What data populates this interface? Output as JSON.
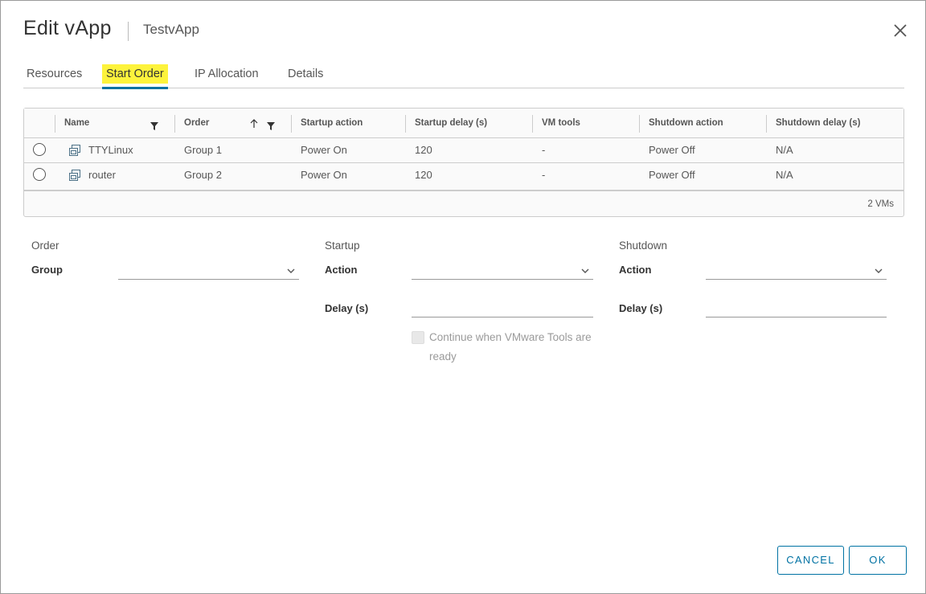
{
  "dialog": {
    "title": "Edit vApp",
    "subtitle": "TestvApp"
  },
  "tabs": [
    {
      "label": "Resources",
      "active": false
    },
    {
      "label": "Start Order",
      "active": true
    },
    {
      "label": "IP Allocation",
      "active": false
    },
    {
      "label": "Details",
      "active": false
    }
  ],
  "grid": {
    "columns": [
      "Name",
      "Order",
      "Startup action",
      "Startup delay (s)",
      "VM tools",
      "Shutdown action",
      "Shutdown delay (s)"
    ],
    "rows": [
      {
        "name": "TTYLinux",
        "order": "Group 1",
        "startup_action": "Power On",
        "startup_delay": "120",
        "vm_tools": "-",
        "shutdown_action": "Power Off",
        "shutdown_delay": "N/A"
      },
      {
        "name": "router",
        "order": "Group 2",
        "startup_action": "Power On",
        "startup_delay": "120",
        "vm_tools": "-",
        "shutdown_action": "Power Off",
        "shutdown_delay": "N/A"
      }
    ],
    "footer": "2 VMs"
  },
  "form": {
    "order": {
      "title": "Order",
      "group_label": "Group",
      "group_value": ""
    },
    "startup": {
      "title": "Startup",
      "action_label": "Action",
      "action_value": "",
      "delay_label": "Delay (s)",
      "delay_value": "",
      "checkbox_label": "Continue when VMware Tools are ready"
    },
    "shutdown": {
      "title": "Shutdown",
      "action_label": "Action",
      "action_value": "",
      "delay_label": "Delay (s)",
      "delay_value": ""
    }
  },
  "buttons": {
    "cancel": "CANCEL",
    "ok": "OK"
  },
  "colors": {
    "accent": "#0072a3",
    "tab_highlight": "#fdf33c",
    "border": "#cccccc"
  }
}
